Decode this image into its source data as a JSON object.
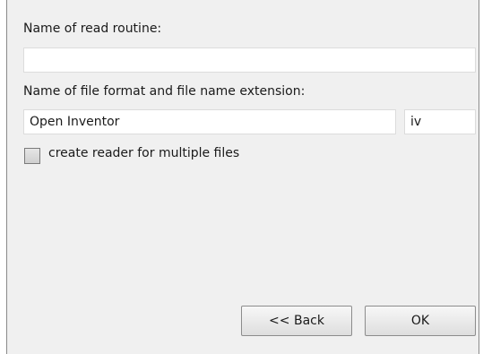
{
  "dialog": {
    "routine_label": "Name of read routine:",
    "routine_value": "",
    "format_label": "Name of file format and file name extension:",
    "format_name_value": "Open Inventor",
    "extension_value": "iv",
    "multi_checkbox_label": "create reader for multiple files",
    "multi_checkbox_checked": false,
    "back_button_label": "<< Back",
    "ok_button_label": "OK"
  }
}
